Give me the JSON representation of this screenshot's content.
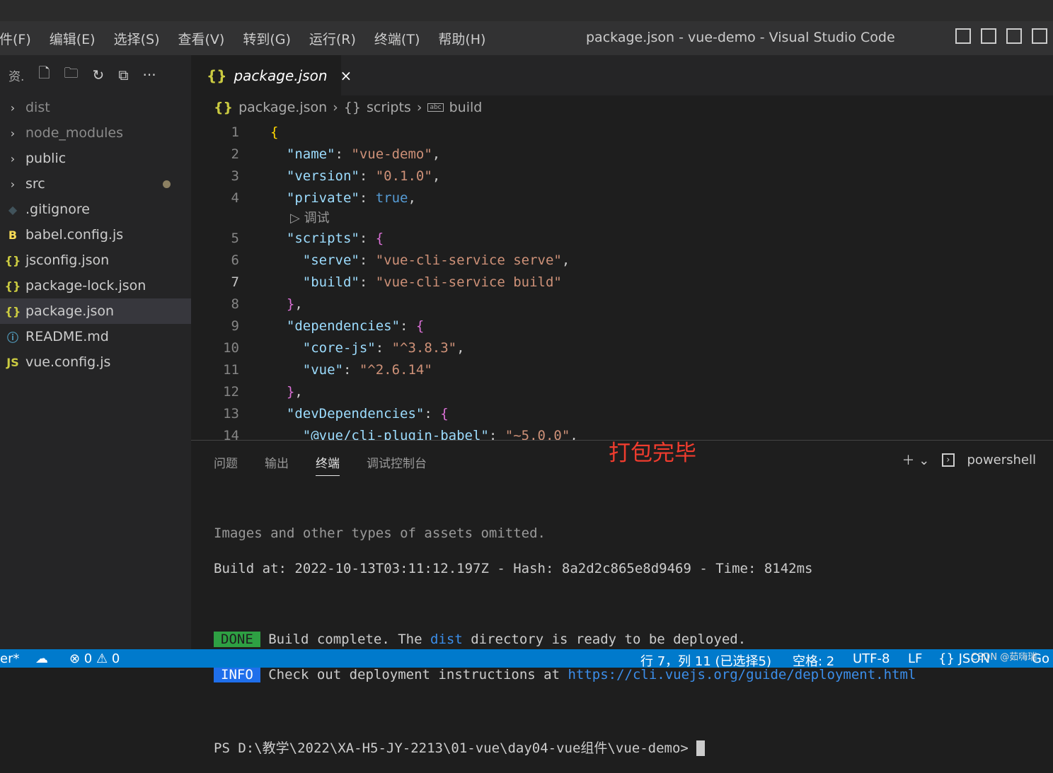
{
  "menu": [
    "件(F)",
    "编辑(E)",
    "选择(S)",
    "查看(V)",
    "转到(G)",
    "运行(R)",
    "终端(T)",
    "帮助(H)"
  ],
  "window_title": "package.json - vue-demo - Visual Studio Code",
  "sidebar": {
    "title": "资.",
    "items": [
      {
        "label": "dist",
        "icon": "chevron-right",
        "dim": true
      },
      {
        "label": "node_modules",
        "icon": "chevron-right",
        "dim": true
      },
      {
        "label": "public",
        "icon": "chevron-right"
      },
      {
        "label": "src",
        "icon": "chevron-right",
        "modified": true
      },
      {
        "label": ".gitignore",
        "icon": "git-icon"
      },
      {
        "label": "babel.config.js",
        "icon": "babel-icon"
      },
      {
        "label": "jsconfig.json",
        "icon": "json-icon"
      },
      {
        "label": "package-lock.json",
        "icon": "json-icon"
      },
      {
        "label": "package.json",
        "icon": "json-icon",
        "selected": true
      },
      {
        "label": "README.md",
        "icon": "info-icon"
      },
      {
        "label": "vue.config.js",
        "icon": "js-icon"
      }
    ]
  },
  "tab": {
    "label": "package.json",
    "close": "×"
  },
  "breadcrumb": [
    "package.json",
    "scripts",
    "build"
  ],
  "code_lens": "▷ 调试",
  "code": [
    {
      "n": "1",
      "seg": [
        [
          "{",
          "#ffd700"
        ]
      ]
    },
    {
      "n": "2",
      "seg": [
        [
          "  \"name\"",
          "#9cdcfe"
        ],
        [
          ": ",
          "#ccc"
        ],
        [
          "\"vue-demo\"",
          "#ce9178"
        ],
        [
          ",",
          "#ccc"
        ]
      ]
    },
    {
      "n": "3",
      "seg": [
        [
          "  \"version\"",
          "#9cdcfe"
        ],
        [
          ": ",
          "#ccc"
        ],
        [
          "\"0.1.0\"",
          "#ce9178"
        ],
        [
          ",",
          "#ccc"
        ]
      ]
    },
    {
      "n": "4",
      "seg": [
        [
          "  \"private\"",
          "#9cdcfe"
        ],
        [
          ": ",
          "#ccc"
        ],
        [
          "true",
          "#569cd6"
        ],
        [
          ",",
          "#ccc"
        ]
      ]
    },
    {
      "n": "5",
      "seg": [
        [
          "  \"scripts\"",
          "#9cdcfe"
        ],
        [
          ": ",
          "#ccc"
        ],
        [
          "{",
          "#da70d6"
        ]
      ]
    },
    {
      "n": "6",
      "seg": [
        [
          "    \"serve\"",
          "#9cdcfe"
        ],
        [
          ": ",
          "#ccc"
        ],
        [
          "\"vue-cli-service serve\"",
          "#ce9178"
        ],
        [
          ",",
          "#ccc"
        ]
      ]
    },
    {
      "n": "7",
      "seg": [
        [
          "    \"build\"",
          "#9cdcfe"
        ],
        [
          ": ",
          "#ccc"
        ],
        [
          "\"vue-cli-service build\"",
          "#ce9178"
        ]
      ]
    },
    {
      "n": "8",
      "seg": [
        [
          "  }",
          "#da70d6"
        ],
        [
          ",",
          "#ccc"
        ]
      ]
    },
    {
      "n": "9",
      "seg": [
        [
          "  \"dependencies\"",
          "#9cdcfe"
        ],
        [
          ": ",
          "#ccc"
        ],
        [
          "{",
          "#da70d6"
        ]
      ]
    },
    {
      "n": "10",
      "seg": [
        [
          "    \"core-js\"",
          "#9cdcfe"
        ],
        [
          ": ",
          "#ccc"
        ],
        [
          "\"^3.8.3\"",
          "#ce9178"
        ],
        [
          ",",
          "#ccc"
        ]
      ]
    },
    {
      "n": "11",
      "seg": [
        [
          "    \"vue\"",
          "#9cdcfe"
        ],
        [
          ": ",
          "#ccc"
        ],
        [
          "\"^2.6.14\"",
          "#ce9178"
        ]
      ]
    },
    {
      "n": "12",
      "seg": [
        [
          "  }",
          "#da70d6"
        ],
        [
          ",",
          "#ccc"
        ]
      ]
    },
    {
      "n": "13",
      "seg": [
        [
          "  \"devDependencies\"",
          "#9cdcfe"
        ],
        [
          ": ",
          "#ccc"
        ],
        [
          "{",
          "#da70d6"
        ]
      ]
    },
    {
      "n": "14",
      "seg": [
        [
          "    \"@vue/cli-plugin-babel\"",
          "#9cdcfe"
        ],
        [
          ": ",
          "#ccc"
        ],
        [
          "\"~5.0.0\"",
          "#ce9178"
        ],
        [
          ",",
          "#ccc"
        ]
      ]
    }
  ],
  "panel": {
    "tabs": [
      "问题",
      "输出",
      "终端",
      "调试控制台"
    ],
    "active": 2,
    "annotation": "打包完毕",
    "shell": "powershell"
  },
  "terminal": {
    "l1": "Images and other types of assets omitted.",
    "l2": "Build at: 2022-10-13T03:11:12.197Z - Hash: 8a2d2c865e8d9469 - Time: 8142ms",
    "done": "DONE",
    "done_pre": "Build complete. The ",
    "done_link": "dist",
    "done_post": " directory is ready to be deployed.",
    "info": "INFO",
    "info_pre": "Check out deployment instructions at ",
    "info_link": "https://cli.vuejs.org/guide/deployment.html",
    "prompt": "PS D:\\教学\\2022\\XA-H5-JY-2213\\01-vue\\day04-vue组件\\vue-demo> "
  },
  "status": {
    "branch": "er*",
    "problems": "⊗ 0 ⚠ 0",
    "position": "行 7，列 11 (已选择5)",
    "spaces": "空格: 2",
    "encoding": "UTF-8",
    "eol": "LF",
    "language": "{} JSON",
    "golive": "Go",
    "watermark": "CSDN @茹嗨瑞"
  },
  "colors": {
    "accent": "#007acc",
    "done": "#2ea043",
    "info": "#1f6feb"
  }
}
